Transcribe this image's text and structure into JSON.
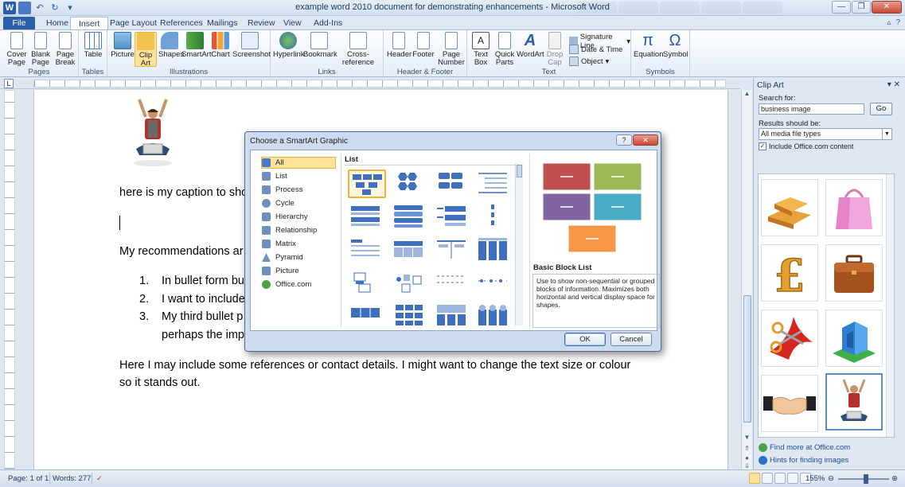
{
  "window": {
    "title": "example word 2010 document for demonstrating enhancements - Microsoft Word",
    "min": "—",
    "max": "❐",
    "close": "✕"
  },
  "ribbon_tabs": [
    "File",
    "Home",
    "Insert",
    "Page Layout",
    "References",
    "Mailings",
    "Review",
    "View",
    "Add-Ins"
  ],
  "ribbon_groups": {
    "pages": {
      "label": "Pages",
      "buttons": [
        "Cover Page",
        "Blank Page",
        "Page Break"
      ]
    },
    "tables": {
      "label": "Tables",
      "buttons": [
        "Table"
      ]
    },
    "illustrations": {
      "label": "Illustrations",
      "buttons": [
        "Picture",
        "Clip Art",
        "Shapes",
        "SmartArt",
        "Chart",
        "Screenshot"
      ]
    },
    "links": {
      "label": "Links",
      "buttons": [
        "Hyperlink",
        "Bookmark",
        "Cross-reference"
      ]
    },
    "header_footer": {
      "label": "Header & Footer",
      "buttons": [
        "Header",
        "Footer",
        "Page Number"
      ]
    },
    "text": {
      "label": "Text",
      "buttons": [
        "Text Box",
        "Quick Parts",
        "WordArt",
        "Drop Cap"
      ],
      "small": [
        "Signature Line",
        "Date & Time",
        "Object"
      ]
    },
    "symbols": {
      "label": "Symbols",
      "buttons": [
        "Equation",
        "Symbol"
      ],
      "glyphs": [
        "π",
        "Ω"
      ]
    }
  },
  "document": {
    "caption": "here is my caption to sho",
    "recommend": "My recommendations ar",
    "bullets": [
      {
        "n": "1.",
        "text": "In bullet form bu"
      },
      {
        "n": "2.",
        "text": "I want to include"
      },
      {
        "n": "3.",
        "text": "My third bullet p"
      }
    ],
    "bullet3_cont": "perhaps the imp",
    "para1": "Here I may include some references or contact details. I might want to change the text size or colour",
    "para2": "so it stands out."
  },
  "dialog": {
    "title": "Choose a SmartArt Graphic",
    "help": "?",
    "close": "✕",
    "categories": [
      "All",
      "List",
      "Process",
      "Cycle",
      "Hierarchy",
      "Relationship",
      "Matrix",
      "Pyramid",
      "Picture",
      "Office.com"
    ],
    "selected_category": "All",
    "gallery_heading": "List",
    "preview_title": "Basic Block List",
    "preview_desc": "Use to show non-sequential or grouped blocks of information. Maximizes both horizontal and vertical display space for shapes.",
    "ok": "OK",
    "cancel": "Cancel",
    "preview_colors": [
      "#c0504d",
      "#9bbb59",
      "#8064a2",
      "#4bacc6",
      "#f79646"
    ]
  },
  "clipart": {
    "title": "Clip Art",
    "close": "✕",
    "search_label": "Search for:",
    "search_value": "business image",
    "go": "Go",
    "results_label": "Results should be:",
    "results_value": "All media file types",
    "include_label": "Include Office.com content",
    "link1": "Find more at Office.com",
    "link2": "Hints for finding images",
    "thumbs": [
      "gold-bars",
      "shopping-bag",
      "pound-sign",
      "briefcase",
      "red-ribbon-scissors",
      "building",
      "handshake",
      "person-laptop"
    ]
  },
  "status": {
    "page": "Page: 1 of 1",
    "words": "Words: 277",
    "zoom": "155%"
  }
}
